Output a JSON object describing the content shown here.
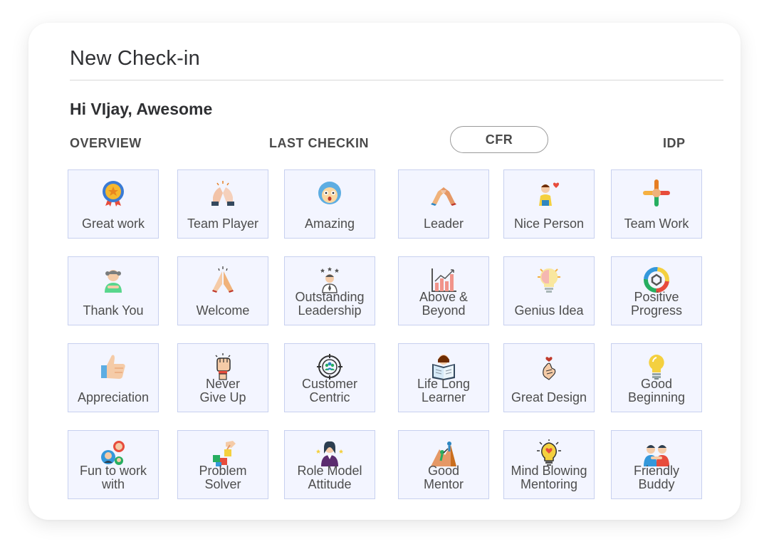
{
  "header": {
    "title": "New Check-in"
  },
  "greeting": "Hi VIjay, Awesome",
  "tabs": [
    {
      "label": "OVERVIEW",
      "active": false
    },
    {
      "label": "LAST CHECKIN",
      "active": false
    },
    {
      "label": "CFR",
      "active": true
    },
    {
      "label": "IDP",
      "active": false
    }
  ],
  "badges": [
    {
      "label": "Great work",
      "icon": "medal-icon"
    },
    {
      "label": "Team Player",
      "icon": "high-five-icon"
    },
    {
      "label": "Amazing",
      "icon": "amazed-face-icon"
    },
    {
      "label": "Leader",
      "icon": "handshake-icon"
    },
    {
      "label": "Nice Person",
      "icon": "person-heart-icon"
    },
    {
      "label": "Team Work",
      "icon": "team-hands-icon"
    },
    {
      "label": "Thank You",
      "icon": "thankful-person-icon"
    },
    {
      "label": "Welcome",
      "icon": "praying-hands-icon"
    },
    {
      "label": "Outstanding\nLeadership",
      "icon": "star-leader-icon"
    },
    {
      "label": "Above &\nBeyond",
      "icon": "growth-chart-icon"
    },
    {
      "label": "Genius Idea",
      "icon": "lightbulb-brain-icon"
    },
    {
      "label": "Positive\nProgress",
      "icon": "progress-ring-icon"
    },
    {
      "label": "Appreciation",
      "icon": "thumbs-up-icon"
    },
    {
      "label": "Never\nGive Up",
      "icon": "raised-fist-icon"
    },
    {
      "label": "Customer\nCentric",
      "icon": "target-people-icon"
    },
    {
      "label": "Life Long\nLearner",
      "icon": "reading-person-icon"
    },
    {
      "label": "Great Design",
      "icon": "finger-heart-icon"
    },
    {
      "label": "Good\nBeginning",
      "icon": "lightbulb-icon"
    },
    {
      "label": "Fun to work\nwith",
      "icon": "friends-chat-icon"
    },
    {
      "label": "Problem\nSolver",
      "icon": "puzzle-hand-icon"
    },
    {
      "label": "Role Model\nAttitude",
      "icon": "role-model-icon"
    },
    {
      "label": "Good\nMentor",
      "icon": "climbing-help-icon"
    },
    {
      "label": "Mind Blowing\nMentoring",
      "icon": "heart-bulb-icon"
    },
    {
      "label": "Friendly\nBuddy",
      "icon": "buddies-icon"
    }
  ],
  "colors": {
    "tile_bg": "#f3f5ff",
    "tile_border": "#c7d0ef",
    "text": "#4d4d4d"
  }
}
